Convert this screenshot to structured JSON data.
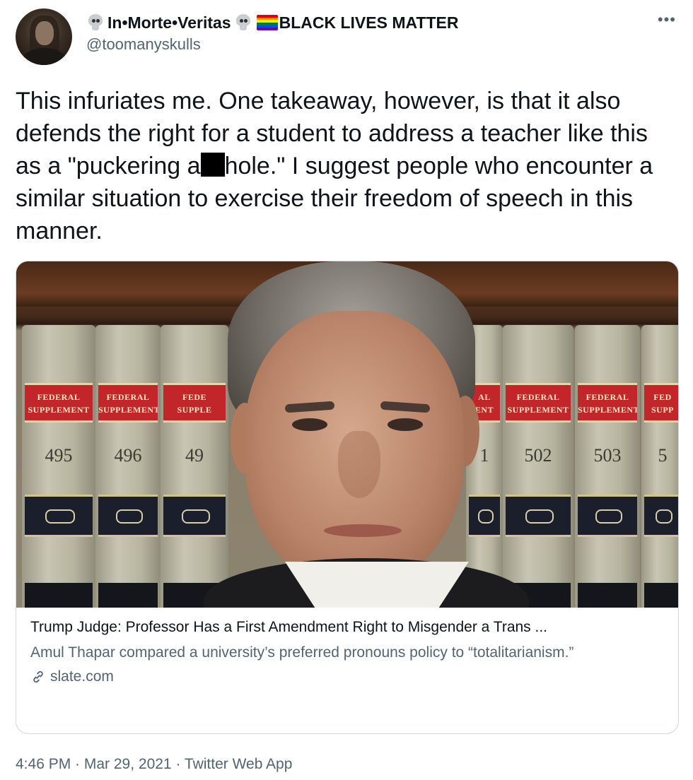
{
  "author": {
    "display_name_part1": "In•Morte•Veritas",
    "display_name_part2": "BLACK LIVES MATTER",
    "handle": "@toomanyskulls",
    "icons": [
      "skull-icon",
      "skull-icon",
      "rainbow-flag-icon"
    ]
  },
  "more_icon": "•••",
  "tweet": {
    "text_before_redaction": "This infuriates me. One takeaway, however, is that it also defends the right for a student to address a teacher like this as a \"puckering a",
    "text_after_redaction": "hole.\" I suggest people who encounter a similar situation to exercise their freedom of speech in this manner."
  },
  "card": {
    "image_subject": "judge-portrait-with-law-books",
    "books": [
      {
        "label_line1": "FEDERAL",
        "label_line2": "SUPPLEMENT",
        "volume": "495"
      },
      {
        "label_line1": "FEDERAL",
        "label_line2": "SUPPLEMENT",
        "volume": "496"
      },
      {
        "label_line1": "FEDE",
        "label_line2": "SUPPLE",
        "volume": "49"
      },
      {
        "label_line1": "AL",
        "label_line2": "ENT",
        "volume": "1"
      },
      {
        "label_line1": "FEDERAL",
        "label_line2": "SUPPLEMENT",
        "volume": "502"
      },
      {
        "label_line1": "FEDERAL",
        "label_line2": "SUPPLEMENT",
        "volume": "503"
      },
      {
        "label_line1": "FED",
        "label_line2": "SUPP",
        "volume": "5"
      }
    ],
    "title": "Trump Judge: Professor Has a First Amendment Right to Misgender a Trans ...",
    "description": "Amul Thapar compared a university’s preferred pronouns policy to “totalitarianism.”",
    "domain": "slate.com"
  },
  "timestamp": "4:46 PM · Mar 29, 2021 · Twitter Web App",
  "colors": {
    "secondary_text": "#536471",
    "primary_text": "#0f1419",
    "card_border": "#cfd9de",
    "rainbow": [
      "#e40303",
      "#ff8c00",
      "#ffed00",
      "#008026",
      "#004dff",
      "#750787"
    ]
  }
}
